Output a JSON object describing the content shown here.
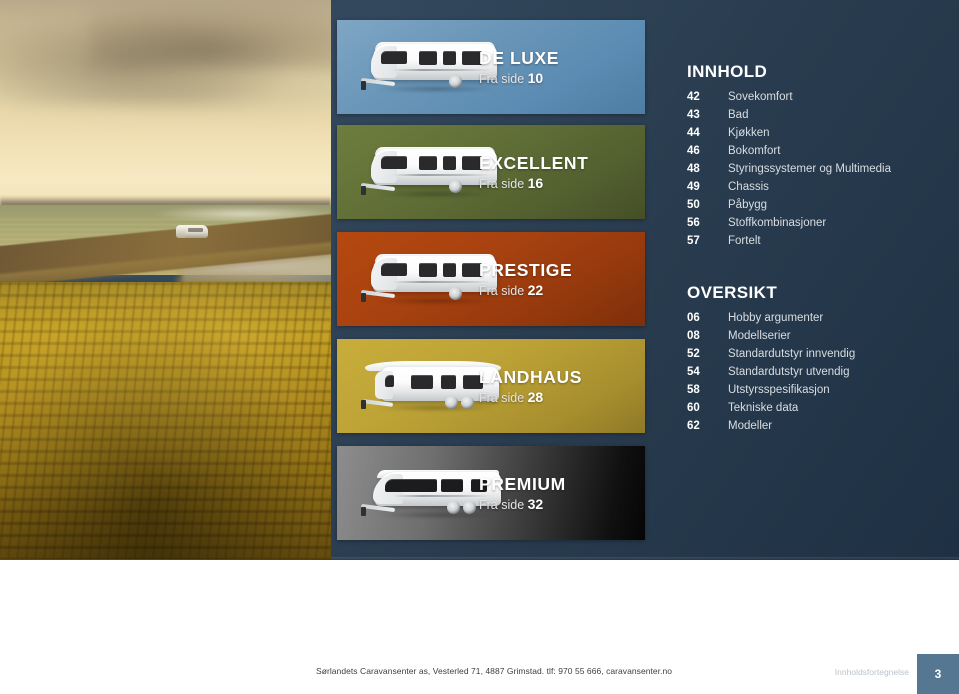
{
  "document": {
    "title": "Innholdsfortegnelse",
    "page_number": "3"
  },
  "photo": {
    "alt": "Coastal road at sunset with a white motorhome driving along the shoreline",
    "caption": ""
  },
  "model_panels": [
    {
      "name": "DE LUXE",
      "from_label": "Fra side",
      "page": "10",
      "color": "#5c8cb3",
      "icon": "caravan-icon"
    },
    {
      "name": "EXCELLENT",
      "from_label": "Fra side",
      "page": "16",
      "color": "#5c6b33",
      "icon": "caravan-icon"
    },
    {
      "name": "PRESTIGE",
      "from_label": "Fra side",
      "page": "22",
      "color": "#9e3c10",
      "icon": "caravan-icon"
    },
    {
      "name": "LANDHAUS",
      "from_label": "Fra side",
      "page": "28",
      "color": "#b49b32",
      "icon": "caravan-icon"
    },
    {
      "name": "PREMIUM",
      "from_label": "Fra side",
      "page": "32",
      "color": "#6e6e6e",
      "icon": "caravan-icon"
    }
  ],
  "toc": {
    "innhold": {
      "heading": "INNHOLD",
      "entries": [
        {
          "page": "42",
          "label": "Sovekomfort"
        },
        {
          "page": "43",
          "label": "Bad"
        },
        {
          "page": "44",
          "label": "Kjøkken"
        },
        {
          "page": "46",
          "label": "Bokomfort"
        },
        {
          "page": "48",
          "label": "Styringssystemer og Multimedia"
        },
        {
          "page": "49",
          "label": "Chassis"
        },
        {
          "page": "50",
          "label": "Påbygg"
        },
        {
          "page": "56",
          "label": "Stoffkombinasjoner"
        },
        {
          "page": "57",
          "label": "Fortelt"
        }
      ]
    },
    "oversikt": {
      "heading": "OVERSIKT",
      "entries": [
        {
          "page": "06",
          "label": "Hobby argumenter"
        },
        {
          "page": "08",
          "label": "Modellserier"
        },
        {
          "page": "52",
          "label": "Standardutstyr innvendig"
        },
        {
          "page": "54",
          "label": "Standardutstyr utvendig"
        },
        {
          "page": "58",
          "label": "Utstyrsspesifikasjon"
        },
        {
          "page": "60",
          "label": "Tekniske data"
        },
        {
          "page": "62",
          "label": "Modeller"
        }
      ]
    }
  },
  "footer": {
    "dealer_line": "Sørlandets Caravansenter as, Vesterled 71, 4887 Grimstad. tlf: 970 55 666, caravansenter.no",
    "section_caption": "Innholdsfortegnelse",
    "page_number": "3",
    "page_box_color": "#567791"
  }
}
